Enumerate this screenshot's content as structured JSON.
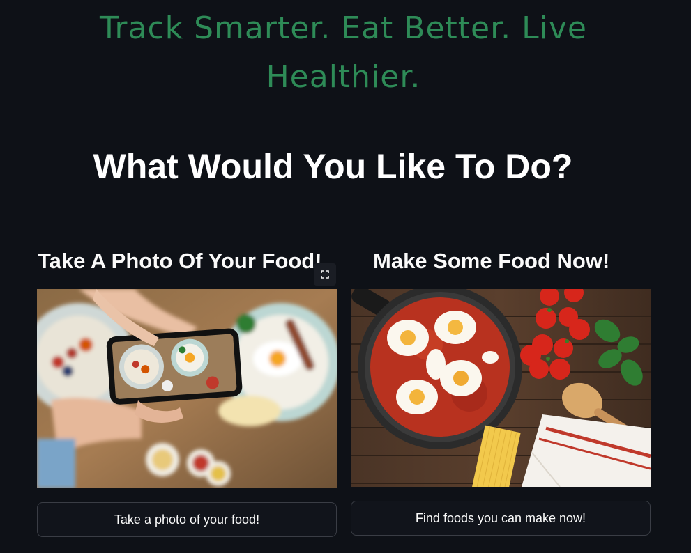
{
  "header": {
    "tagline": "Track Smarter. Eat Better. Live Healthier.",
    "heading": "What Would You Like To Do?"
  },
  "options": [
    {
      "title": "Take A Photo Of Your Food!",
      "image": "photo-of-food-with-phone",
      "button_label": "Take a photo of your food!"
    },
    {
      "title": "Make Some Food Now!",
      "image": "shakshuka-pan-with-tomatoes-basil-spaghetti",
      "button_label": "Find foods you can make now!"
    }
  ],
  "icons": {
    "fullscreen": "expand-icon"
  },
  "colors": {
    "background": "#0e1117",
    "tagline": "#2e8b57",
    "button_border": "#3a3d45"
  }
}
